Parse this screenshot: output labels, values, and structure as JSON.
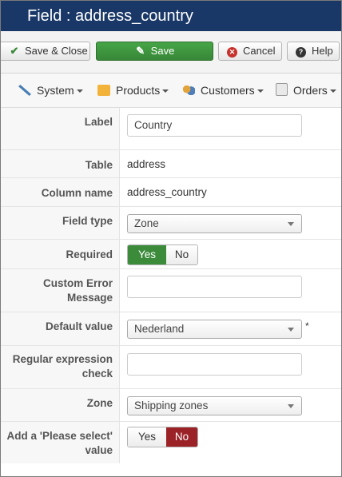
{
  "window": {
    "title": "Field : address_country"
  },
  "toolbar": {
    "save_close": "Save & Close",
    "save": "Save",
    "cancel": "Cancel",
    "help": "Help"
  },
  "menu": {
    "system": "System",
    "products": "Products",
    "customers": "Customers",
    "orders": "Orders"
  },
  "form": {
    "label": {
      "label": "Label",
      "value": "Country"
    },
    "table": {
      "label": "Table",
      "value": "address"
    },
    "column_name": {
      "label": "Column name",
      "value": "address_country"
    },
    "field_type": {
      "label": "Field type",
      "value": "Zone"
    },
    "required": {
      "label": "Required",
      "yes": "Yes",
      "no": "No",
      "selected": "Yes"
    },
    "custom_error": {
      "label_line1": "Custom Error",
      "label_line2": "Message",
      "value": ""
    },
    "default_value": {
      "label": "Default value",
      "value": "Nederland",
      "marker": "*"
    },
    "regex": {
      "label_line1": "Regular expression",
      "label_line2": "check",
      "value": ""
    },
    "zone": {
      "label": "Zone",
      "value": "Shipping zones"
    },
    "please_select": {
      "label_line1": "Add a 'Please select'",
      "label_line2": "value",
      "yes": "Yes",
      "no": "No",
      "selected": "No"
    }
  },
  "colors": {
    "title_bar": "#1a3867",
    "save_green": "#46a546",
    "yes_green": "#3b8b3b",
    "no_red": "#9b2226"
  }
}
